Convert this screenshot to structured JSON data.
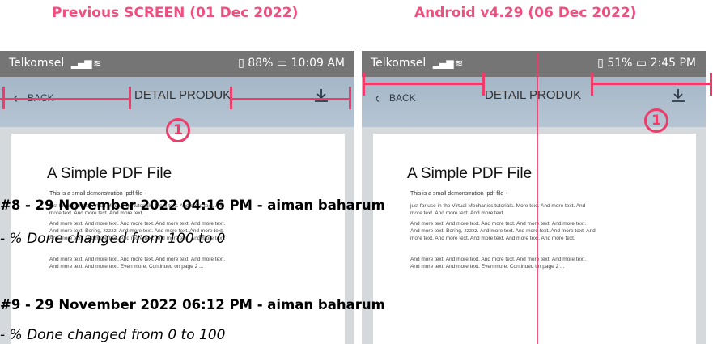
{
  "headings": {
    "left": "Previous SCREEN (01 Dec 2022)",
    "right": "Android v4.29 (06 Dec 2022)"
  },
  "colors": {
    "accent": "#ee3b6a",
    "heading": "#ef4f7f",
    "appbar": "#a4b6c7",
    "statusbar": "#757575"
  },
  "left_phone": {
    "carrier": "Telkomsel",
    "status_right": "88%",
    "time": "10:09 AM",
    "back_label": "BACK",
    "title": "DETAIL PRODUK",
    "download_icon": "download-icon",
    "pdf": {
      "title": "A Simple PDF File",
      "subtitle": "This is a small demonstration .pdf file -",
      "para1": "just for use in the Virtual Mechanics tutorials. More text. And more text. And more text. And more text. And more text.",
      "para2": "And more text. And more text. And more text. And more text. And more text. And more text. Boring, zzzzz. And more text. And more text. And more text. And more text. And more text. And more text. And more text. And more text.",
      "para3": "And more text. And more text. And more text. And more text. And more text. And more text. And more text. Even more. Continued on page 2 ..."
    },
    "marker": "1"
  },
  "right_phone": {
    "carrier": "Telkomsel",
    "status_right": "51%",
    "time": "2:45 PM",
    "back_label": "BACK",
    "title": "DETAIL PRODUK",
    "download_icon": "download-icon",
    "pdf": {
      "title": "A Simple PDF File",
      "subtitle": "This is a small demonstration .pdf file -",
      "para1": "just for use in the Virtual Mechanics tutorials. More text. And more text. And more text. And more text. And more text.",
      "para2": "And more text. And more text. And more text. And more text. And more text. And more text. Boring, zzzzz. And more text. And more text. And more text. And more text. And more text. And more text. And more text. And more text.",
      "para3": "And more text. And more text. And more text. And more text. And more text. And more text. And more text. Even more. Continued on page 2 ..."
    },
    "marker": "1"
  },
  "journal": [
    {
      "title": "#8 - 29 November 2022 04:16 PM - aiman baharum",
      "change": "- % Done changed from 100 to 0"
    },
    {
      "title": "#9 - 29 November 2022 06:12 PM - aiman baharum",
      "change": "- % Done changed from 0 to 100"
    }
  ]
}
